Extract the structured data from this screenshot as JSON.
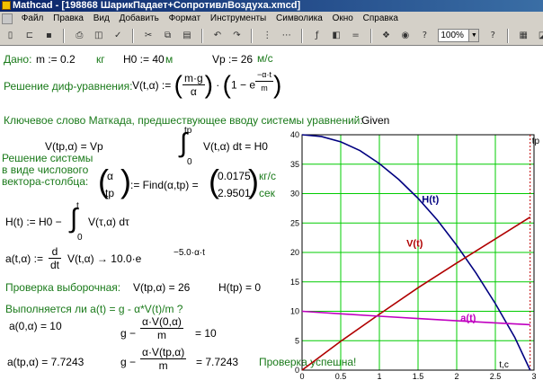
{
  "window": {
    "title": "Mathcad - [198868 ШарикПадает+СопротивлВоздуха.xmcd]"
  },
  "menu": [
    "Файл",
    "Правка",
    "Вид",
    "Добавить",
    "Формат",
    "Инструменты",
    "Символика",
    "Окно",
    "Справка"
  ],
  "toolbar": {
    "zoom": "100%"
  },
  "doc": {
    "given_label": "Дано:",
    "m_expr": "m := 0.2",
    "m_unit": "кг",
    "h0_expr": "H0 := 40",
    "h0_unit": "м",
    "vp_expr": "Vp := 26",
    "vp_unit": "м/с",
    "solution_label": "Решение диф-уравнения:",
    "v_lhs": "V(t,α) :=",
    "v_num": "m·g",
    "v_den": "α",
    "v_exp_num": "−α·t",
    "v_exp_den": "m",
    "keyword_text": "Ключевое слово Маткада, предшествующее вводу системы уравнений:",
    "keyword": "Given",
    "eq1": "V(tp,α) = Vp",
    "int_upper": "tp",
    "int_lower": "0",
    "eq2_body": "V(t,α) dt = H0",
    "system_line1": "Решение системы",
    "system_line2": "в виде  числового",
    "system_line3": "вектора-столбца:",
    "find_vec1": "α",
    "find_vec2": "tp",
    "find_call": ":= Find(α,tp) =",
    "res1": "0.0175",
    "res2": "2.9501",
    "res1_unit": "кг/с",
    "res2_unit": "сек",
    "h_lhs": "H(t) := H0 −",
    "h_int_upper": "t",
    "h_int_lower": "0",
    "h_body": "V(τ,α) dτ",
    "a_lhs": "a(t,α) :=",
    "a_d_num": "d",
    "a_d_den": "dt",
    "a_rhs": "V(t,α) → 10.0·e",
    "a_exp": "−5.0·α·t",
    "check_label": "Проверка выборочная:",
    "check1": "V(tp,α) = 26",
    "check2": "H(tp) = 0",
    "question": "Выполняется ли a(t) = g - α*V(t)/m  ?",
    "a0": "a(0,α) = 10",
    "g_minus": "g −",
    "frac1_num": "α·V(0,α)",
    "frac_den": "m",
    "frac1_val": "= 10",
    "atp": "a(tp,α) = 7.7243",
    "frac2_num": "α·V(tp,α)",
    "frac2_val": "= 7.7243",
    "success": "Проверка успешна!"
  },
  "chart_data": {
    "type": "line",
    "xlim": [
      0,
      3
    ],
    "ylim": [
      0,
      40
    ],
    "x_ticks": [
      "0",
      "0.5",
      "1",
      "1.5",
      "2",
      "2.5",
      "3"
    ],
    "y_ticks": [
      "0",
      "5",
      "10",
      "15",
      "20",
      "25",
      "30",
      "35",
      "40"
    ],
    "grid": true,
    "xlabel": "t,c",
    "marker_label": "tp",
    "marker_x": 2.9501,
    "series": [
      {
        "name": "H(t)",
        "color": "#000080",
        "x": [
          0,
          0.25,
          0.5,
          0.75,
          1,
          1.25,
          1.5,
          1.75,
          2,
          2.25,
          2.5,
          2.75,
          2.9501
        ],
        "y": [
          40,
          39.7,
          38.8,
          37.3,
          35.1,
          32.4,
          29.2,
          25.5,
          21.2,
          16.5,
          11.3,
          5.6,
          0
        ]
      },
      {
        "name": "V(t)",
        "color": "#b00000",
        "x": [
          0,
          0.5,
          1,
          1.5,
          2,
          2.5,
          2.9501
        ],
        "y": [
          0,
          4.9,
          9.5,
          14.0,
          18.2,
          22.3,
          26
        ]
      },
      {
        "name": "a(t)",
        "color": "#c000c0",
        "x": [
          0,
          0.5,
          1,
          1.5,
          2,
          2.5,
          2.9501
        ],
        "y": [
          10,
          9.57,
          9.16,
          8.77,
          8.39,
          8.03,
          7.72
        ]
      }
    ]
  }
}
